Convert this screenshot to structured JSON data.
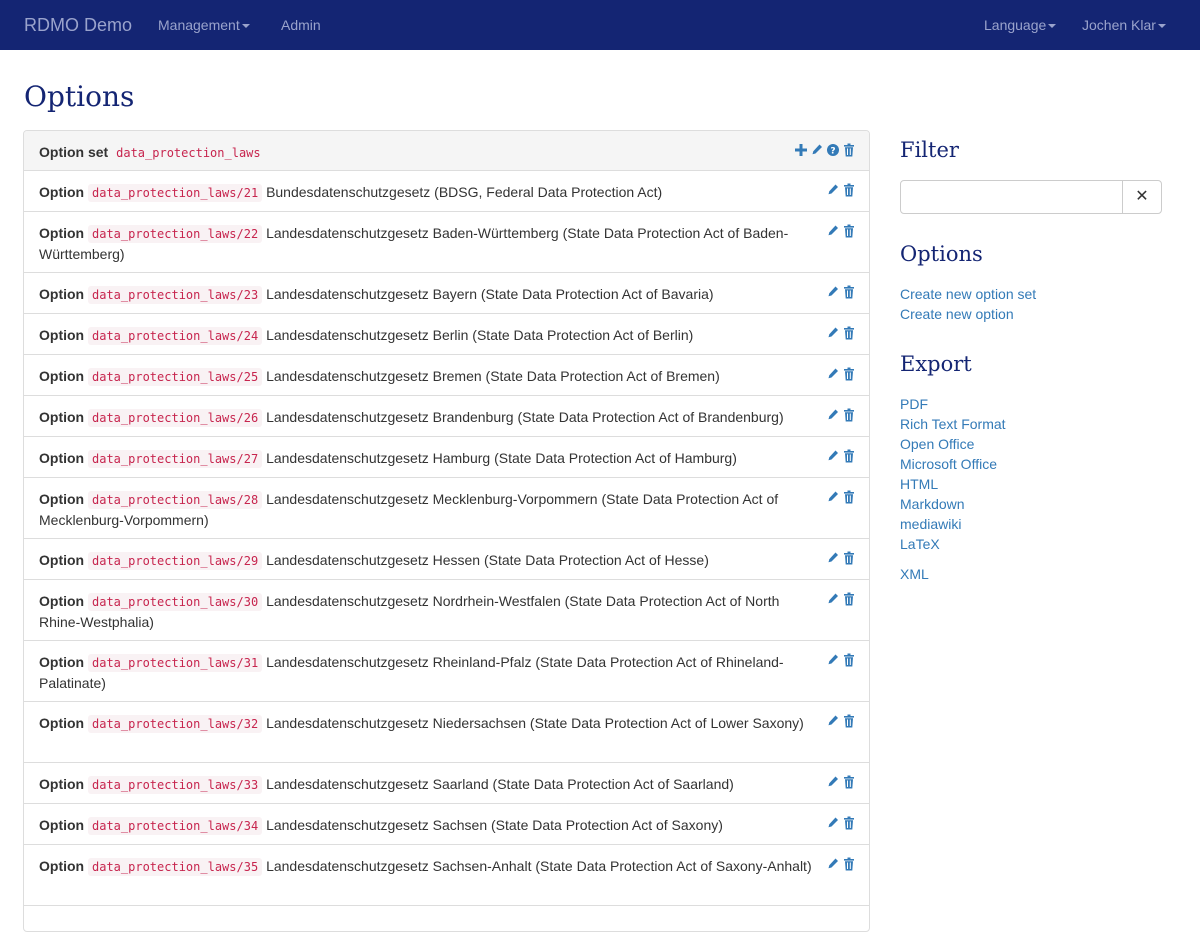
{
  "navbar": {
    "brand": "RDMO Demo",
    "management": "Management",
    "admin": "Admin",
    "language": "Language",
    "user": "Jochen Klar"
  },
  "page": {
    "title": "Options"
  },
  "option_set": {
    "label": "Option set",
    "key": "data_protection_laws"
  },
  "option_label": "Option",
  "options": [
    {
      "key": "data_protection_laws/21",
      "text": "Bundesdatenschutzgesetz (BDSG, Federal Data Protection Act)"
    },
    {
      "key": "data_protection_laws/22",
      "text": "Landesdatenschutzgesetz Baden-Württemberg (State Data Protection Act of Baden-Württemberg)"
    },
    {
      "key": "data_protection_laws/23",
      "text": "Landesdatenschutzgesetz Bayern (State Data Protection Act of Bavaria)"
    },
    {
      "key": "data_protection_laws/24",
      "text": "Landesdatenschutzgesetz Berlin (State Data Protection Act of Berlin)"
    },
    {
      "key": "data_protection_laws/25",
      "text": "Landesdatenschutzgesetz Bremen (State Data Protection Act of Bremen)"
    },
    {
      "key": "data_protection_laws/26",
      "text": "Landesdatenschutzgesetz Brandenburg (State Data Protection Act of Brandenburg)"
    },
    {
      "key": "data_protection_laws/27",
      "text": "Landesdatenschutzgesetz Hamburg (State Data Protection Act of Hamburg)"
    },
    {
      "key": "data_protection_laws/28",
      "text": "Landesdatenschutzgesetz Mecklenburg-Vorpommern (State Data Protection Act of Mecklenburg-Vorpommern)"
    },
    {
      "key": "data_protection_laws/29",
      "text": "Landesdatenschutzgesetz Hessen (State Data Protection Act of Hesse)"
    },
    {
      "key": "data_protection_laws/30",
      "text": "Landesdatenschutzgesetz Nordrhein-Westfalen (State Data Protection Act of North Rhine-Westphalia)"
    },
    {
      "key": "data_protection_laws/31",
      "text": "Landesdatenschutzgesetz Rheinland-Pfalz (State Data Protection Act of Rhineland-Palatinate)"
    },
    {
      "key": "data_protection_laws/32",
      "text": "Landesdatenschutzgesetz Niedersachsen (State Data Protection Act of Lower Saxony)"
    },
    {
      "key": "data_protection_laws/33",
      "text": "Landesdatenschutzgesetz Saarland (State Data Protection Act of Saarland)"
    },
    {
      "key": "data_protection_laws/34",
      "text": "Landesdatenschutzgesetz Sachsen (State Data Protection Act of Saxony)"
    },
    {
      "key": "data_protection_laws/35",
      "text": "Landesdatenschutzgesetz Sachsen-Anhalt (State Data Protection Act of Saxony-Anhalt)"
    }
  ],
  "sidebar": {
    "filter_title": "Filter",
    "filter_value": "",
    "options_title": "Options",
    "create_option_set": "Create new option set",
    "create_option": "Create new option",
    "export_title": "Export",
    "export_links": [
      "PDF",
      "Rich Text Format",
      "Open Office",
      "Microsoft Office",
      "HTML",
      "Markdown",
      "mediawiki",
      "LaTeX",
      "XML"
    ]
  },
  "colors": {
    "navbar_bg": "#142573",
    "title": "#142573",
    "link": "#337ab7",
    "code": "#c7254e",
    "code_bg": "#f9f2f4",
    "icon": "#337ab7"
  }
}
